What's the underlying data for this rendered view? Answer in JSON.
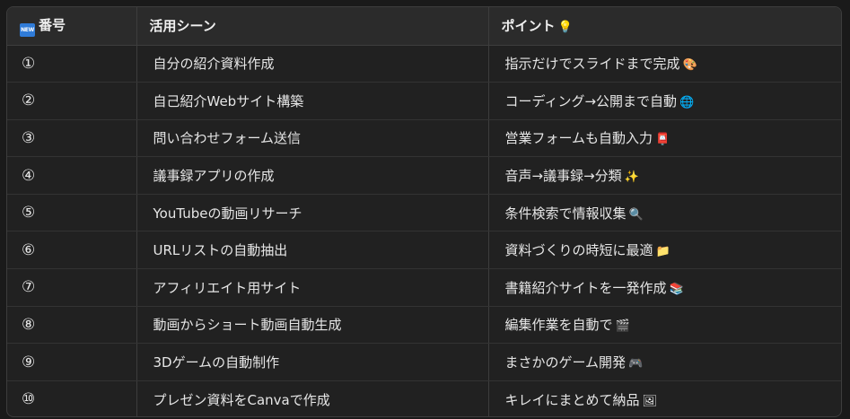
{
  "table": {
    "headers": {
      "badge": "NEW",
      "col1": "番号",
      "col2": "活用シーン",
      "col3": "ポイント",
      "col3_emoji": "💡"
    },
    "rows": [
      {
        "num": "①",
        "use": "自分の紹介資料作成",
        "point": "指示だけでスライドまで完成",
        "emoji": "🎨",
        "emoji_icon": "palette-icon"
      },
      {
        "num": "②",
        "use": "自己紹介Webサイト構築",
        "point": "コーディング→公開まで自動",
        "emoji": "🌐",
        "emoji_icon": "globe-icon"
      },
      {
        "num": "③",
        "use": "問い合わせフォーム送信",
        "point": "営業フォームも自動入力",
        "emoji": "📮",
        "emoji_icon": "postbox-icon"
      },
      {
        "num": "④",
        "use": "議事録アプリの作成",
        "point": "音声→議事録→分類",
        "emoji": "✨",
        "emoji_icon": "sparkles-icon"
      },
      {
        "num": "⑤",
        "use": "YouTubeの動画リサーチ",
        "point": "条件検索で情報収集",
        "emoji": "🔍",
        "emoji_icon": "magnifier-icon"
      },
      {
        "num": "⑥",
        "use": "URLリストの自動抽出",
        "point": "資料づくりの時短に最適",
        "emoji": "📁",
        "emoji_icon": "folder-icon"
      },
      {
        "num": "⑦",
        "use": "アフィリエイト用サイト",
        "point": "書籍紹介サイトを一発作成",
        "emoji": "📚",
        "emoji_icon": "books-icon"
      },
      {
        "num": "⑧",
        "use": "動画からショート動画自動生成",
        "point": "編集作業を自動で",
        "emoji": "🎬",
        "emoji_icon": "clapper-icon"
      },
      {
        "num": "⑨",
        "use": "3Dゲームの自動制作",
        "point": "まさかのゲーム開発",
        "emoji": "🎮",
        "emoji_icon": "gamepad-icon"
      },
      {
        "num": "⑩",
        "use": "プレゼン資料をCanvaで作成",
        "point": "キレイにまとめて納品",
        "emoji": "🖼",
        "emoji_icon": "picture-icon"
      }
    ]
  },
  "colors": {
    "background": "#1a1a1a",
    "header_bg": "#2b2b2b",
    "table_bg": "#212121",
    "border": "#3d3d3d",
    "badge": "#2f7bd8"
  }
}
